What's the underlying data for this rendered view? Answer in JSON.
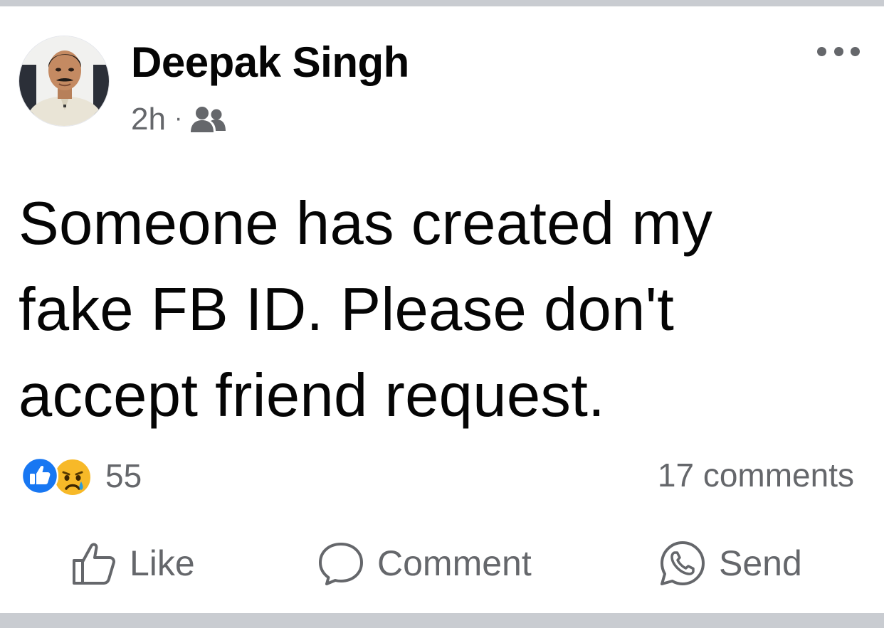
{
  "post": {
    "author": {
      "name": "Deepak Singh",
      "avatar_icon": "profile-photo"
    },
    "time": "2h",
    "separator": "·",
    "audience_icon": "friends-icon",
    "more_icon": "more-options-icon",
    "text": "Someone has created my\nfake FB ID.  Please don't\naccept friend request."
  },
  "reactions": {
    "icons": [
      "like-reaction-icon",
      "sad-reaction-icon"
    ],
    "count": "55"
  },
  "comments": {
    "label": "17 comments"
  },
  "actions": {
    "like": {
      "label": "Like",
      "icon": "thumbs-up-icon"
    },
    "comment": {
      "label": "Comment",
      "icon": "speech-bubble-icon"
    },
    "send": {
      "label": "Send",
      "icon": "whatsapp-icon"
    }
  },
  "colors": {
    "primary_text": "#050505",
    "secondary_text": "#65676b",
    "like_blue": "#1877f2",
    "sad_yellow": "#f7b928",
    "divider": "#c9ccd1"
  }
}
